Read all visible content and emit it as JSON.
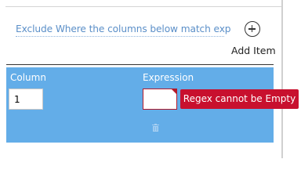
{
  "link": {
    "exclude_text": "Exclude Where the columns below match exp"
  },
  "add_item": {
    "label": "Add Item",
    "icon": "plus-circle-icon"
  },
  "table": {
    "headers": {
      "column": "Column",
      "expression": "Expression"
    },
    "row": {
      "column_value": "1",
      "expression_value": ""
    }
  },
  "validation": {
    "message": "Regex cannot be Empty"
  },
  "colors": {
    "panel": "#63ade8",
    "error": "#c8102e",
    "link": "#5b8fc8"
  },
  "icons": {
    "delete": "trash-icon"
  }
}
